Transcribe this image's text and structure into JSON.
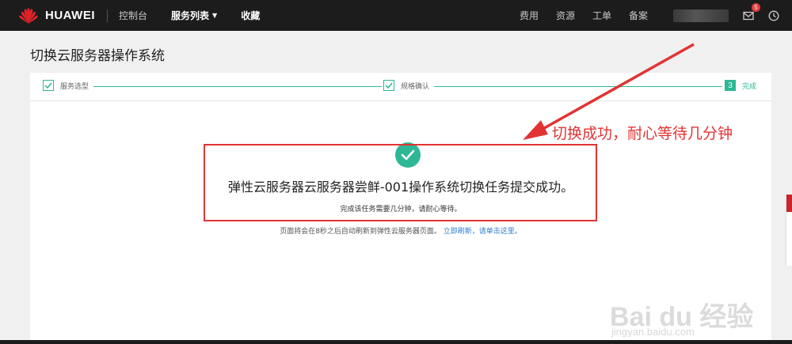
{
  "nav": {
    "brand": "HUAWEI",
    "links": [
      "控制台",
      "服务列表",
      "收藏"
    ],
    "right_links": [
      "费用",
      "资源",
      "工单",
      "备案"
    ],
    "mail_badge": "5"
  },
  "page": {
    "title": "切换云服务器操作系统"
  },
  "steps": [
    {
      "label": "服务选型"
    },
    {
      "label": "规格确认"
    },
    {
      "number": "3",
      "label": "完成"
    }
  ],
  "result": {
    "main": "弹性云服务器云服务器尝鲜-001操作系统切换任务提交成功。",
    "sub": "完成该任务需要几分钟，请耐心等待。",
    "redirect_text": "页面将会在8秒之后自动刷新到弹性云服务器页面。",
    "redirect_link": "立即刷新，请单击这里。"
  },
  "annotation": {
    "text": "切换成功，耐心等待几分钟"
  },
  "watermark": {
    "main": "Bai du 经验",
    "sub": "jingyan.baidu.com"
  },
  "colors": {
    "accent": "#2db795",
    "annotation": "#e23333",
    "nav_bg": "#1c1c1c",
    "link": "#2d7fd1"
  }
}
